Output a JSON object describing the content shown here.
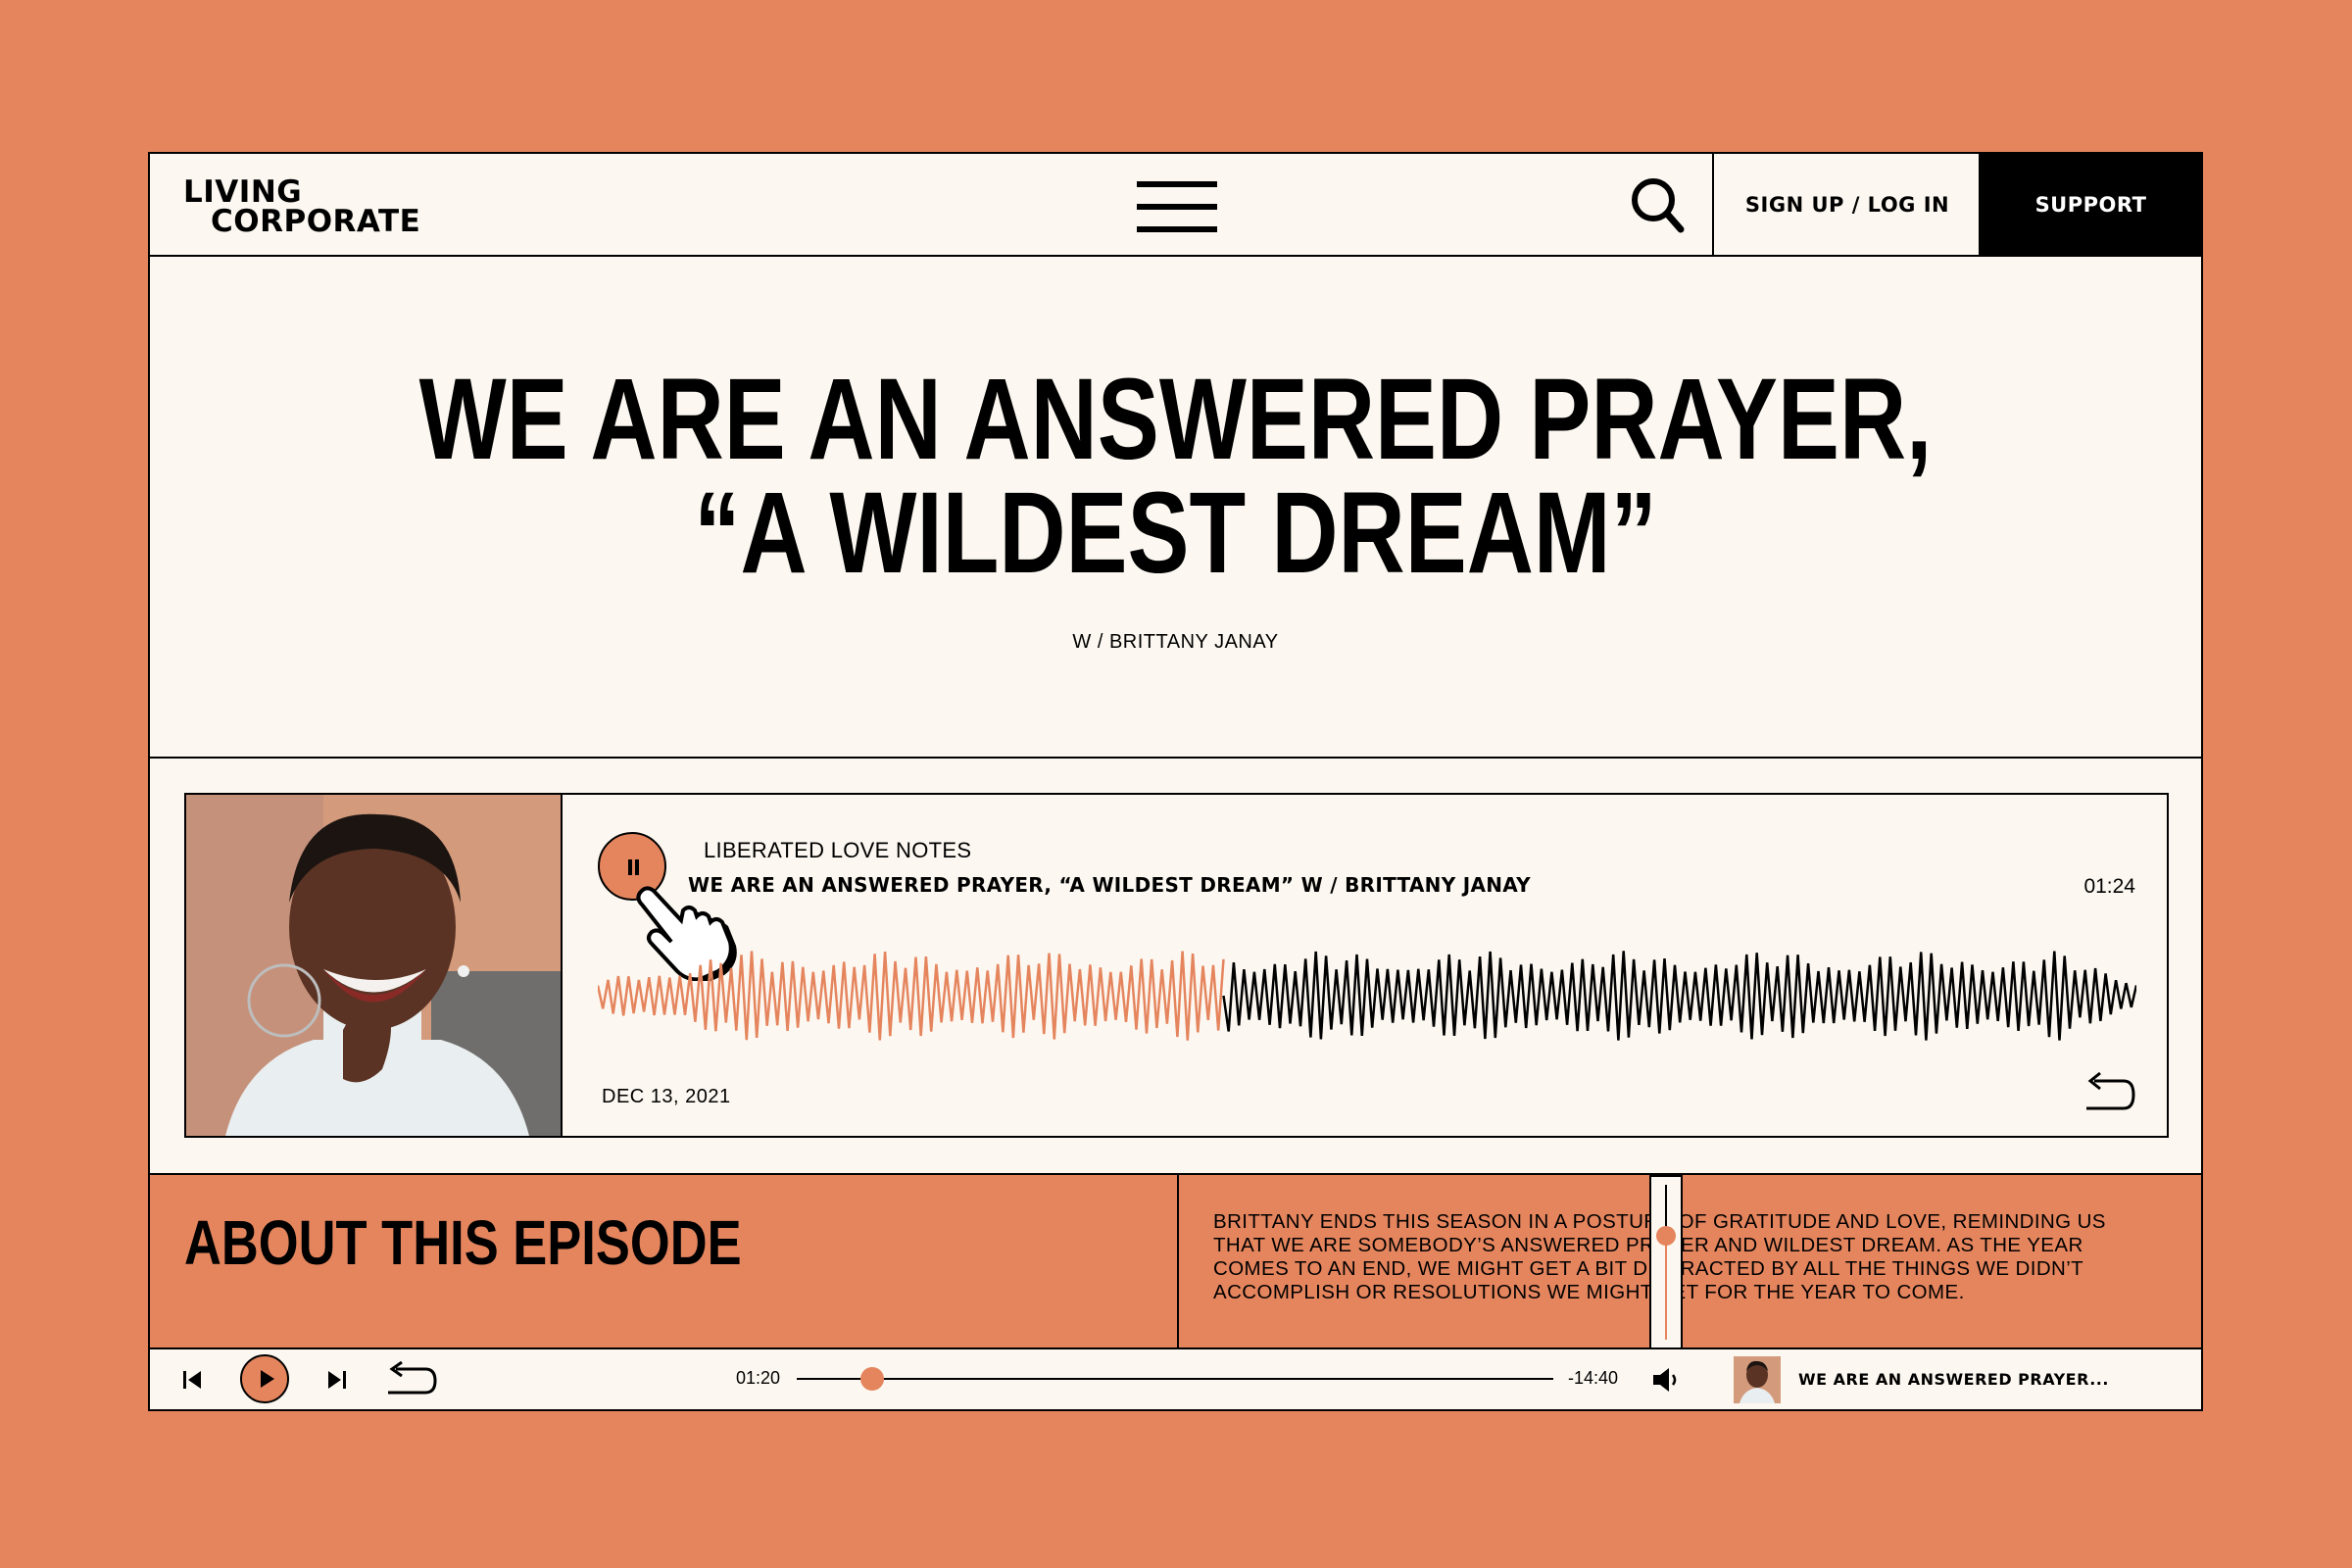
{
  "brand": {
    "line1": "LIVING",
    "line2": "CORPORATE"
  },
  "header": {
    "signup_label": "SIGN UP / LOG IN",
    "support_label": "SUPPORT",
    "menu_icon": "hamburger-menu-icon",
    "search_icon": "search-icon"
  },
  "hero": {
    "title_line1": "WE ARE AN ANSWERED PRAYER,",
    "title_line2": "“A WILDEST DREAM”",
    "subtitle": "W / BRITTANY JANAY"
  },
  "player": {
    "show_name": "LIBERATED LOVE NOTES",
    "episode_title": "WE ARE AN ANSWERED PRAYER, “A WILDEST DREAM” W / BRITTANY JANAY",
    "time": "01:24",
    "date": "DEC 13, 2021",
    "state": "playing",
    "progress_fraction": 0.41
  },
  "about": {
    "heading": "ABOUT THIS EPISODE",
    "text": "BRITTANY ENDS THIS SEASON IN A POSTURE OF GRATITUDE AND LOVE, REMINDING US THAT WE ARE SOMEBODY’S ANSWERED PRAYER AND WILDEST DREAM. AS THE YEAR COMES TO AN END, WE MIGHT GET A BIT DISTRACTED BY ALL THE THINGS WE DIDN’T ACCOMPLISH OR RESOLUTIONS WE MIGHT SET FOR THE YEAR TO COME.",
    "volume_level": 0.67
  },
  "bottom_bar": {
    "elapsed": "01:20",
    "remaining": "-14:40",
    "progress_fraction": 0.1,
    "now_playing": "WE ARE AN ANSWERED PRAYER..."
  },
  "colors": {
    "accent": "#e5855e",
    "background": "#fcf8f1",
    "ink": "#000000"
  }
}
